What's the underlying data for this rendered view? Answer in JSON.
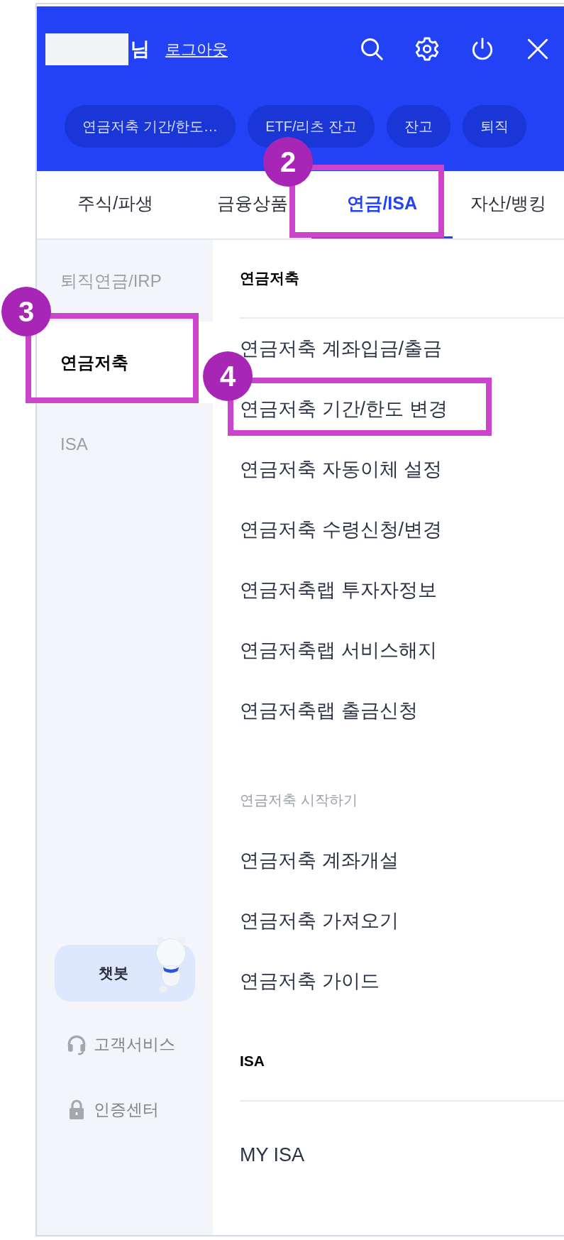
{
  "header": {
    "name_suffix": "님",
    "logout_link": "로그아웃"
  },
  "shortcut_chips": [
    "연금저축 기간/한도…",
    "ETF/리츠 잔고",
    "잔고",
    "퇴직"
  ],
  "tabs": [
    {
      "label": "주식/파생",
      "selected": false
    },
    {
      "label": "금융상품",
      "selected": false
    },
    {
      "label": "연금/ISA",
      "selected": true
    },
    {
      "label": "자산/뱅킹",
      "selected": false
    }
  ],
  "sidebar": {
    "items": [
      {
        "label": "퇴직연금/IRP",
        "selected": false
      },
      {
        "label": "연금저축",
        "selected": true
      },
      {
        "label": "ISA",
        "selected": false
      }
    ],
    "chatbot_button": "챗봇",
    "links": [
      {
        "kind": "support",
        "label": "고객서비스"
      },
      {
        "kind": "certificate",
        "label": "인증센터"
      }
    ]
  },
  "menu": {
    "sections": [
      {
        "kind": "heading",
        "title": "연금저축",
        "items": [
          "연금저축 계좌입금/출금",
          "연금저축 기간/한도 변경",
          "연금저축 자동이체 설정",
          "연금저축 수령신청/변경",
          "연금저축랩 투자자정보",
          "연금저축랩 서비스해지",
          "연금저축랩 출금신청"
        ]
      },
      {
        "kind": "subheading",
        "title": "연금저축 시작하기",
        "items": [
          "연금저축 계좌개설",
          "연금저축 가져오기",
          "연금저축 가이드"
        ]
      },
      {
        "kind": "heading",
        "title": "ISA",
        "items": [
          "MY ISA"
        ]
      }
    ]
  },
  "annotations": [
    {
      "number": "2",
      "kind": "tab"
    },
    {
      "number": "3",
      "kind": "sidebar"
    },
    {
      "number": "4",
      "kind": "menu"
    }
  ]
}
